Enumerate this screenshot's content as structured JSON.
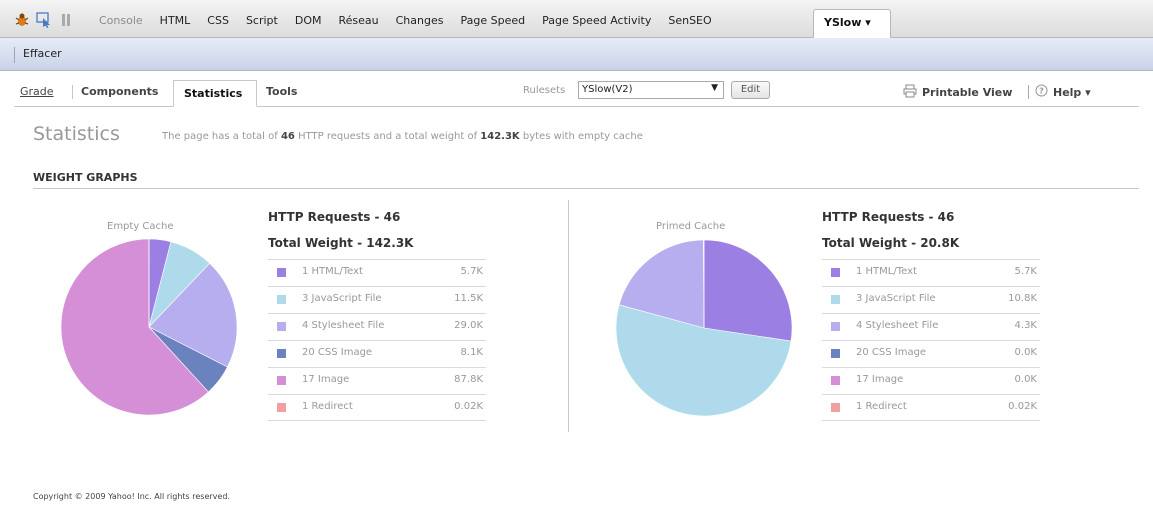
{
  "firebug": {
    "tabs": [
      {
        "label": "Console",
        "dim": true
      },
      {
        "label": "HTML",
        "dim": false
      },
      {
        "label": "CSS",
        "dim": false
      },
      {
        "label": "Script",
        "dim": false
      },
      {
        "label": "DOM",
        "dim": false
      },
      {
        "label": "Réseau",
        "dim": false
      },
      {
        "label": "Changes",
        "dim": false
      },
      {
        "label": "Page Speed",
        "dim": false
      },
      {
        "label": "Page Speed Activity",
        "dim": false
      },
      {
        "label": "SenSEO",
        "dim": false
      }
    ],
    "active_tab": "YSlow ▾",
    "toolbar_clear": "Effacer"
  },
  "yslow": {
    "tabs": {
      "grade": "Grade",
      "components": "Components",
      "statistics": "Statistics",
      "tools": "Tools"
    },
    "rulesets_label": "Rulesets",
    "rulesets_value": "YSlow(V2)",
    "edit_label": "Edit",
    "printable_view": "Printable View",
    "help": "Help ▾"
  },
  "stats": {
    "title": "Statistics",
    "summary_pre": "The page has a total of ",
    "requests": "46",
    "summary_mid": " HTTP requests and a total weight of ",
    "weight": "142.3K",
    "summary_post": " bytes with empty cache",
    "weight_graphs": "WEIGHT GRAPHS",
    "copyright": "Copyright © 2009 Yahoo! Inc. All rights reserved."
  },
  "colors": {
    "html": "#9c7fe3",
    "js": "#aedaeb",
    "css": "#b7aef0",
    "cssimg": "#6a82bd",
    "image": "#d58fd6",
    "redirect": "#f0a0a0"
  },
  "chart_data": [
    {
      "type": "pie",
      "title": "Empty Cache",
      "requests": "HTTP Requests - 46",
      "weight": "Total Weight - 142.3K",
      "slices": [
        {
          "count": "1",
          "name": "HTML/Text",
          "value": 5.7,
          "label": "5.7K"
        },
        {
          "count": "3",
          "name": "JavaScript File",
          "value": 11.5,
          "label": "11.5K"
        },
        {
          "count": "4",
          "name": "Stylesheet File",
          "value": 29.0,
          "label": "29.0K"
        },
        {
          "count": "20",
          "name": "CSS Image",
          "value": 8.1,
          "label": "8.1K"
        },
        {
          "count": "17",
          "name": "Image",
          "value": 87.8,
          "label": "87.8K"
        },
        {
          "count": "1",
          "name": "Redirect",
          "value": 0.02,
          "label": "0.02K"
        }
      ]
    },
    {
      "type": "pie",
      "title": "Primed Cache",
      "requests": "HTTP Requests - 46",
      "weight": "Total Weight - 20.8K",
      "slices": [
        {
          "count": "1",
          "name": "HTML/Text",
          "value": 5.7,
          "label": "5.7K"
        },
        {
          "count": "3",
          "name": "JavaScript File",
          "value": 10.8,
          "label": "10.8K"
        },
        {
          "count": "4",
          "name": "Stylesheet File",
          "value": 4.3,
          "label": "4.3K"
        },
        {
          "count": "20",
          "name": "CSS Image",
          "value": 0.0,
          "label": "0.0K"
        },
        {
          "count": "17",
          "name": "Image",
          "value": 0.0,
          "label": "0.0K"
        },
        {
          "count": "1",
          "name": "Redirect",
          "value": 0.02,
          "label": "0.02K"
        }
      ]
    }
  ]
}
